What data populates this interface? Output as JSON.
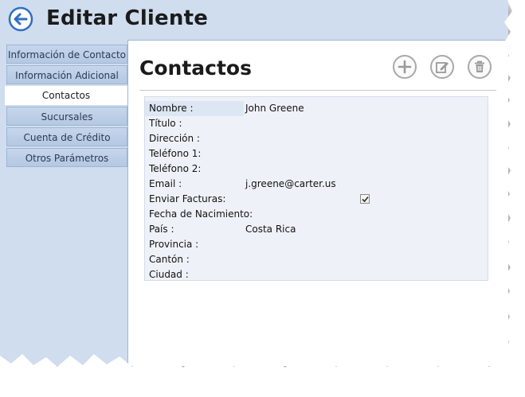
{
  "header": {
    "title": "Editar Cliente",
    "back_icon": "back-arrow-icon"
  },
  "sidebar": {
    "items": [
      {
        "label": "Información de Contacto",
        "active": false
      },
      {
        "label": "Información Adicional",
        "active": false
      },
      {
        "label": "Contactos",
        "active": true
      },
      {
        "label": "Sucursales",
        "active": false
      },
      {
        "label": "Cuenta de Crédito",
        "active": false
      },
      {
        "label": "Otros Parámetros",
        "active": false
      }
    ]
  },
  "main": {
    "title": "Contactos",
    "toolbar": {
      "add_icon": "plus-icon",
      "edit_icon": "edit-icon",
      "delete_icon": "trash-icon"
    },
    "fields": [
      {
        "label": "Nombre :",
        "value": "John Greene"
      },
      {
        "label": "Título :",
        "value": ""
      },
      {
        "label": "Dirección :",
        "value": ""
      },
      {
        "label": "Teléfono 1:",
        "value": ""
      },
      {
        "label": "Teléfono 2:",
        "value": ""
      },
      {
        "label": "Email :",
        "value": "j.greene@carter.us"
      },
      {
        "label": "Enviar Facturas:",
        "value": "",
        "checked": true
      },
      {
        "label": "Fecha de Nacimiento:",
        "value": ""
      },
      {
        "label": "País :",
        "value": "Costa Rica"
      },
      {
        "label": "Provincia :",
        "value": ""
      },
      {
        "label": "Cantón :",
        "value": ""
      },
      {
        "label": "Ciudad :",
        "value": ""
      }
    ]
  },
  "colors": {
    "window_bg": "#cfddee",
    "accent": "#2e6fc2"
  }
}
